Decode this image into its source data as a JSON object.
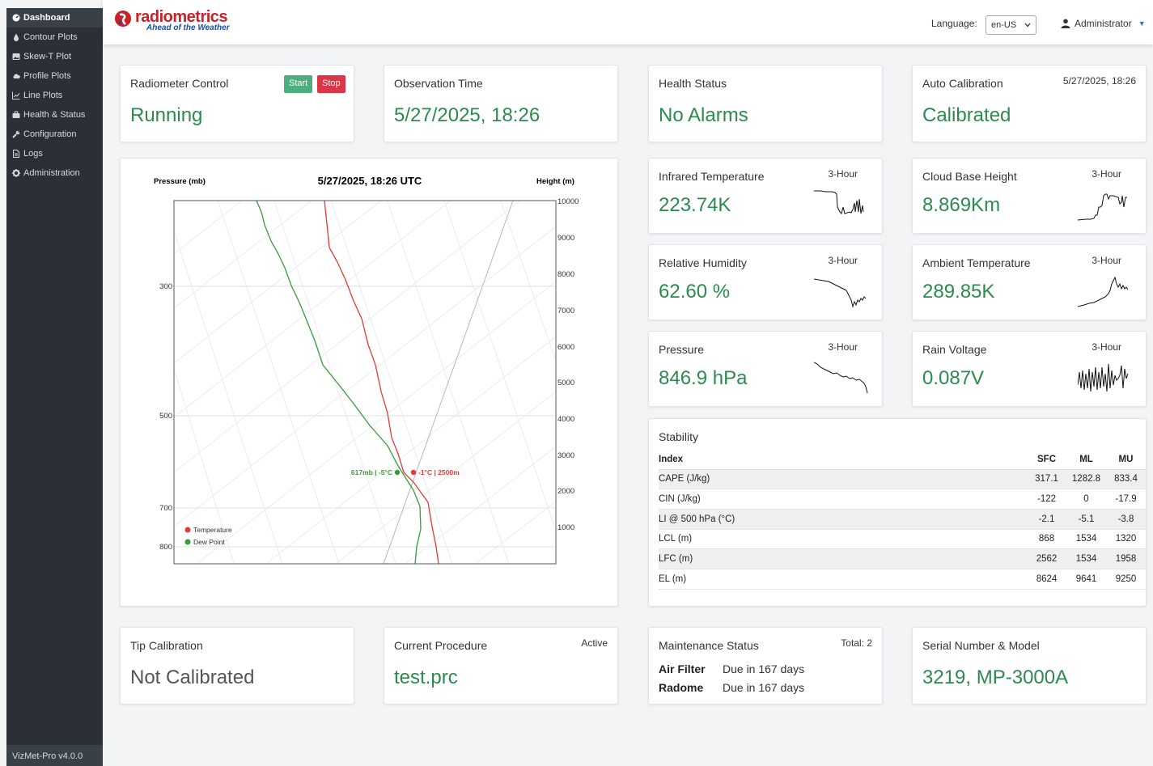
{
  "sidebar": {
    "items": [
      {
        "label": "Dashboard",
        "icon": "gauge-icon"
      },
      {
        "label": "Contour Plots",
        "icon": "drop-icon"
      },
      {
        "label": "Skew-T Plot",
        "icon": "image-icon"
      },
      {
        "label": "Profile Plots",
        "icon": "cloud-icon"
      },
      {
        "label": "Line Plots",
        "icon": "line-chart-icon"
      },
      {
        "label": "Health & Status",
        "icon": "briefcase-icon"
      },
      {
        "label": "Configuration",
        "icon": "wrench-icon"
      },
      {
        "label": "Logs",
        "icon": "file-icon"
      },
      {
        "label": "Administration",
        "icon": "gear-icon"
      }
    ],
    "version": "VizMet-Pro v4.0.0"
  },
  "header": {
    "logo_name": "radiometrics",
    "logo_tagline": "Ahead of the Weather",
    "language_label": "Language:",
    "language_value": "en-US",
    "user": "Administrator"
  },
  "colors": {
    "accent_green": "#2c8a4f",
    "brand_red": "#cc2027",
    "brand_blue": "#1a4c9b",
    "sidebar": "#2b3036"
  },
  "radiometer": {
    "title": "Radiometer Control",
    "start_label": "Start",
    "stop_label": "Stop",
    "value": "Running"
  },
  "observation": {
    "title": "Observation Time",
    "value": "5/27/2025, 18:26"
  },
  "health": {
    "title": "Health Status",
    "value": "No Alarms"
  },
  "autocal": {
    "title": "Auto Calibration",
    "time": "5/27/2025, 18:26",
    "value": "Calibrated"
  },
  "skewt": {
    "title": "5/27/2025, 18:26 UTC",
    "left_axis_label": "Pressure (mb)",
    "right_axis_label": "Height (m)",
    "pressure_ticks": [
      "300",
      "500",
      "700",
      "800"
    ],
    "height_ticks": [
      "10000",
      "9000",
      "8000",
      "7000",
      "6000",
      "5000",
      "4000",
      "3000",
      "2000",
      "1000"
    ],
    "temp_label": "-1°C | 2500m",
    "dew_label": "617mb | -5°C",
    "legend_temperature": "Temperature",
    "legend_dewpoint": "Dew Point"
  },
  "metrics": [
    {
      "title": "Infrared Temperature",
      "period": "3-Hour",
      "value": "223.74K"
    },
    {
      "title": "Cloud Base Height",
      "period": "3-Hour",
      "value": "8.869Km"
    },
    {
      "title": "Relative Humidity",
      "period": "3-Hour",
      "value": "62.60 %"
    },
    {
      "title": "Ambient Temperature",
      "period": "3-Hour",
      "value": "289.85K"
    },
    {
      "title": "Pressure",
      "period": "3-Hour",
      "value": "846.9 hPa"
    },
    {
      "title": "Rain Voltage",
      "period": "3-Hour",
      "value": "0.087V"
    }
  ],
  "stability": {
    "title": "Stability",
    "headers": [
      "Index",
      "SFC",
      "ML",
      "MU"
    ],
    "rows": [
      [
        "CAPE (J/kg)",
        "317.1",
        "1282.8",
        "833.4"
      ],
      [
        "CIN (J/kg)",
        "-122",
        "0",
        "-17.9"
      ],
      [
        "LI @ 500 hPa (°C)",
        "-2.1",
        "-5.1",
        "-3.8"
      ],
      [
        "LCL (m)",
        "868",
        "1534",
        "1320"
      ],
      [
        "LFC (m)",
        "2562",
        "1534",
        "1958"
      ],
      [
        "EL (m)",
        "8624",
        "9641",
        "9250"
      ]
    ]
  },
  "tip": {
    "title": "Tip Calibration",
    "value": "Not Calibrated"
  },
  "procedure": {
    "title": "Current Procedure",
    "status": "Active",
    "value": "test.prc"
  },
  "maintenance": {
    "title": "Maintenance Status",
    "total": "Total: 2",
    "items": [
      {
        "name": "Air Filter",
        "due": "Due in 167 days"
      },
      {
        "name": "Radome",
        "due": "Due in 167 days"
      }
    ]
  },
  "serial": {
    "title": "Serial Number & Model",
    "value": "3219, MP-3000A"
  }
}
